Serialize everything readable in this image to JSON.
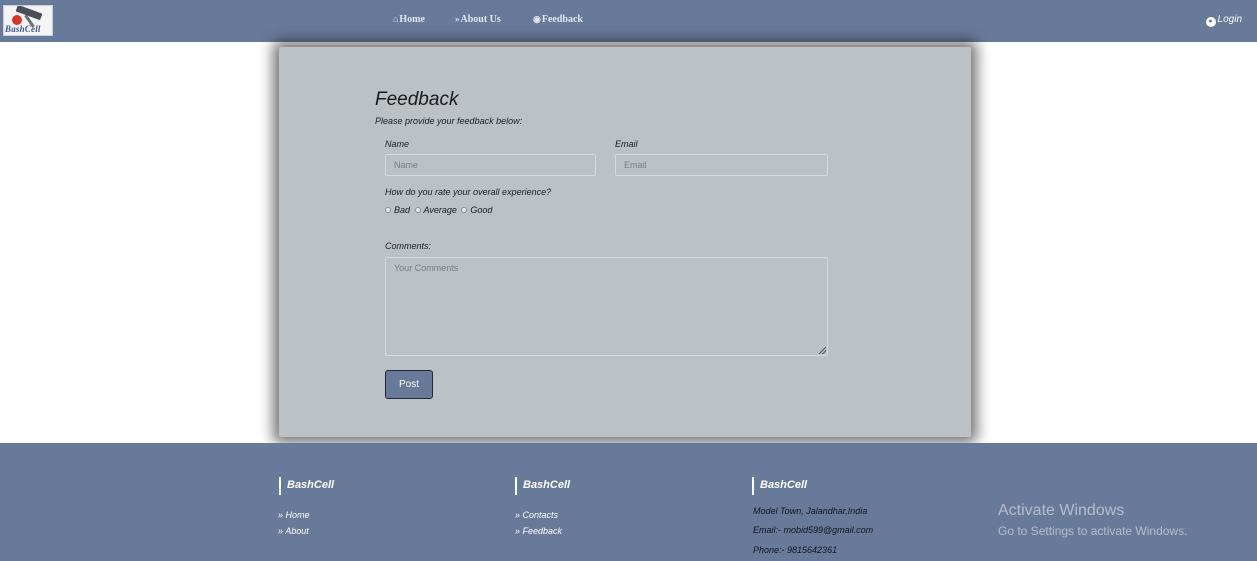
{
  "brand": {
    "logo_text": "BashCell",
    "icon": "gavel-logo"
  },
  "nav": {
    "items": [
      {
        "label": "Home",
        "icon": "home-icon",
        "glyph": "⌂"
      },
      {
        "label": "About Us",
        "icon": "double-chevron-icon",
        "glyph": "»"
      },
      {
        "label": "Feedback",
        "icon": "feedback-icon",
        "glyph": "◉"
      }
    ],
    "login_label": "Login",
    "login_icon": "user-circle-icon"
  },
  "form": {
    "title": "Feedback",
    "subtitle": "Please provide your feedback below:",
    "name_label": "Name",
    "name_placeholder": "Name",
    "email_label": "Email",
    "email_placeholder": "Email",
    "rating_question": "How do you rate your overall experience?",
    "rating_options": [
      "Bad",
      "Average",
      "Good"
    ],
    "comments_label": "Comments:",
    "comments_placeholder": "Your Comments",
    "submit_label": "Post"
  },
  "footer": {
    "columns": [
      {
        "heading": "BashCell",
        "links": [
          "Home",
          "About"
        ]
      },
      {
        "heading": "BashCell",
        "links": [
          "Contacts",
          "Feedback"
        ]
      },
      {
        "heading": "BashCell",
        "info": [
          "Model Town, Jalandhar,India",
          "Email:- mobid599@gmail.com",
          "Phone:- 9815642361"
        ]
      }
    ],
    "link_glyph": "»"
  },
  "watermark": {
    "title": "Activate Windows",
    "subtitle": "Go to Settings to activate Windows."
  },
  "colors": {
    "navbar": "#687a99",
    "card": "#bcc1c6",
    "button": "#687a99",
    "page": "#ffffff"
  }
}
